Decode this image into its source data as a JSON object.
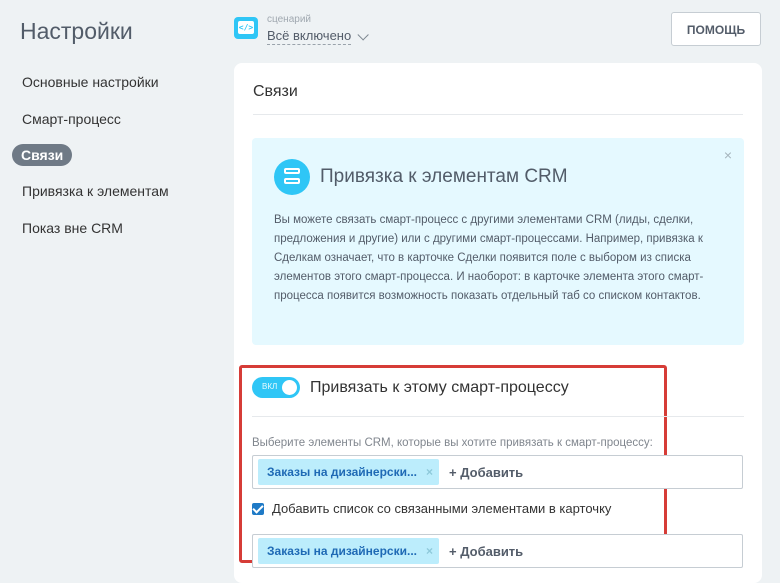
{
  "page": {
    "title": "Настройки"
  },
  "sidebar": {
    "items": [
      {
        "label": "Основные настройки"
      },
      {
        "label": "Смарт-процесс"
      },
      {
        "label": "Связи"
      },
      {
        "label": "Привязка к элементам"
      },
      {
        "label": "Показ вне CRM"
      }
    ]
  },
  "header": {
    "scenario_label": "сценарий",
    "scenario_value": "Всё включено",
    "scenario_icon_glyph": "</>",
    "help_label": "ПОМОЩЬ"
  },
  "main": {
    "section_title": "Связи",
    "info": {
      "title": "Привязка к элементам CRM",
      "close_glyph": "×",
      "text": "Вы можете связать смарт-процесс с другими элементами CRM (лиды, сделки, предложения и другие) или с другими смарт-процессами. Например, привязка к Сделкам означает, что в карточке Сделки появится поле с выбором из списка элементов этого смарт-процесса. И наоборот: в карточке элемента этого смарт-процесса появится возможность показать отдельный таб со списком контактов."
    },
    "binding": {
      "toggle_label": "ВКЛ",
      "toggle_on": true,
      "title": "Привязать к этому смарт-процессу",
      "select_hint": "Выберите элементы CRM, которые вы хотите привязать к смарт-процессу:",
      "tag1": "Заказы на дизайнерски...",
      "tag_remove_glyph": "×",
      "add_label": "+ Добавить",
      "checkbox_checked": true,
      "checkbox_label": "Добавить список со связанными элементами в карточку",
      "tag2": "Заказы на дизайнерски...",
      "add_label2": "+ Добавить"
    }
  },
  "colors": {
    "accent": "#2fc6f6",
    "highlight": "#d63c37",
    "sidebar_active": "#6f7a86",
    "tag_bg": "#bcedfc"
  }
}
